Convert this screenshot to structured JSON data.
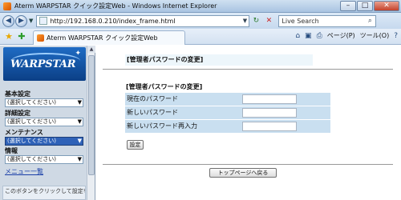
{
  "window": {
    "title": "Aterm WARPSTAR クイック設定Web - Windows Internet Explorer",
    "min_glyph": "–",
    "max_glyph": "□",
    "close_glyph": "✕"
  },
  "address_bar": {
    "back_glyph": "◀",
    "forward_glyph": "▶",
    "url": "http://192.168.0.210/index_frame.html",
    "refresh_glyph": "↻",
    "stop_glyph": "✕",
    "search_placeholder": "Live Search",
    "search_glyph": "⌕"
  },
  "tab": {
    "label": "Aterm WARPSTAR クイック設定Web"
  },
  "commands": {
    "home_glyph": "⌂",
    "feeds_glyph": "▣",
    "print_glyph": "⎙",
    "page_label": "ページ(P)",
    "tools_label": "ツール(O)",
    "help_glyph": "?"
  },
  "sidebar": {
    "logo_text": "WARPSTAR",
    "sections": [
      {
        "heading": "基本設定",
        "selected": "(選択してください)"
      },
      {
        "heading": "詳細設定",
        "selected": "(選択してください)"
      },
      {
        "heading": "メンテナンス",
        "selected": "(選択してください)"
      },
      {
        "heading": "情報",
        "selected": "(選択してください)"
      }
    ],
    "menu_list_link": "メニュー一覧",
    "note": "このボタンをクリックして設定を保存します。WARPSTARを再"
  },
  "main": {
    "page_title": "[管理者パスワードの変更]",
    "section_title": "[管理者パスワードの変更]",
    "fields": [
      {
        "label": "現在のパスワード",
        "value": ""
      },
      {
        "label": "新しいパスワード",
        "value": ""
      },
      {
        "label": "新しいパスワード再入力",
        "value": ""
      }
    ],
    "set_button": "設定",
    "top_button": "トップページへ戻る"
  },
  "colors": {
    "field_bg": "#c9dff0",
    "highlight_select": "#2f62b8",
    "logo_bg": "#1f6cc4"
  }
}
